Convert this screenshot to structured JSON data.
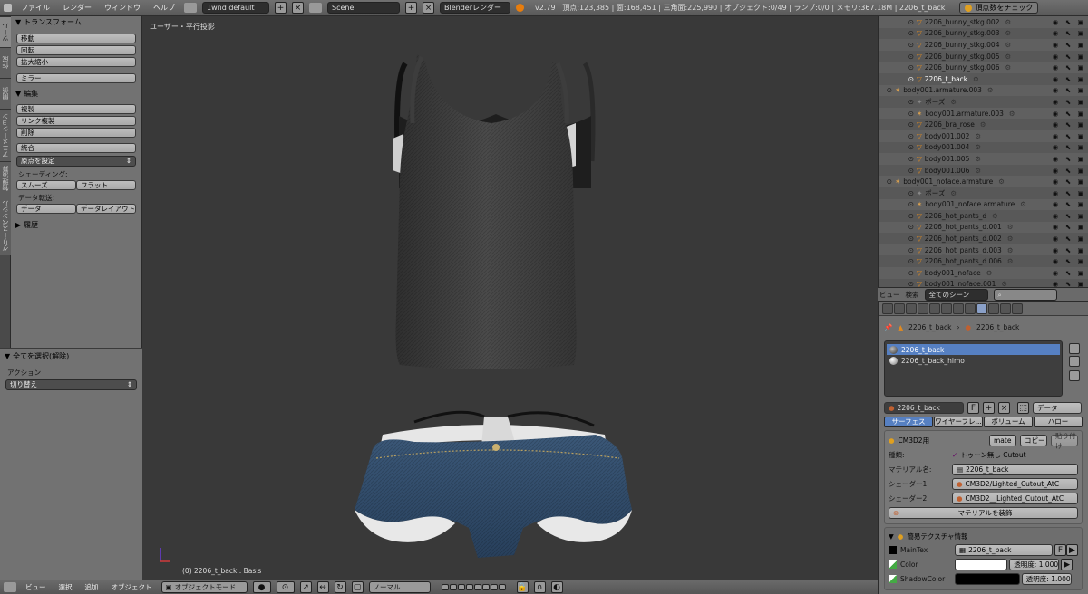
{
  "topbar": {
    "menus": [
      "ファイル",
      "レンダー",
      "ウィンドウ",
      "ヘルプ"
    ],
    "layout": "1wnd default",
    "scene": "Scene",
    "engine": "Blenderレンダー",
    "stats": "v2.79 | 頂点:123,385 | 面:168,451 | 三角面:225,990 | オブジェクト:0/49 | ランプ:0/0 | メモリ:367.18M | 2206_t_back",
    "check_button": "頂点数をチェック"
  },
  "vtabs": [
    "ツール",
    "作成",
    "関係",
    "アニメーション",
    "物理演算",
    "グリースペンシル"
  ],
  "tools": {
    "transform_header": "トランスフォーム",
    "transform_buttons": [
      "移動",
      "回転",
      "拡大縮小"
    ],
    "mirror": "ミラー",
    "edit_header": "編集",
    "edit_buttons": [
      "複製",
      "リンク複製",
      "削除"
    ],
    "join": "統合",
    "origin": "原点を設定",
    "shading_label": "シェーディング:",
    "smooth": "スムーズ",
    "flat": "フラット",
    "data_transfer_label": "データ転送:",
    "data": "データ",
    "data_layout": "データレイアウト",
    "history": "履歴"
  },
  "operator": {
    "header": "全てを選択(解除)",
    "action_label": "アクション",
    "action_value": "切り替え"
  },
  "viewport": {
    "label": "ユーザー・平行投影",
    "status": "(0) 2206_t_back : Basis"
  },
  "bottombar": {
    "menus": [
      "ビュー",
      "選択",
      "追加",
      "オブジェクト"
    ],
    "mode": "オブジェクトモード",
    "pivot": "ノーマル"
  },
  "outliner": {
    "rows": [
      {
        "name": "2206_bunny_stkg.002",
        "indent": 3,
        "icon": "mesh"
      },
      {
        "name": "2206_bunny_stkg.003",
        "indent": 3,
        "icon": "mesh"
      },
      {
        "name": "2206_bunny_stkg.004",
        "indent": 3,
        "icon": "mesh"
      },
      {
        "name": "2206_bunny_stkg.005",
        "indent": 3,
        "icon": "mesh"
      },
      {
        "name": "2206_bunny_stkg.006",
        "indent": 3,
        "icon": "mesh"
      },
      {
        "name": "2206_t_back",
        "indent": 3,
        "icon": "mesh",
        "selected": true
      },
      {
        "name": "body001.armature.003",
        "indent": 1,
        "icon": "armature"
      },
      {
        "name": "ポーズ",
        "indent": 3,
        "icon": "pose"
      },
      {
        "name": "body001.armature.003",
        "indent": 3,
        "icon": "armature"
      },
      {
        "name": "2206_bra_rose",
        "indent": 3,
        "icon": "mesh"
      },
      {
        "name": "body001.002",
        "indent": 3,
        "icon": "mesh"
      },
      {
        "name": "body001.004",
        "indent": 3,
        "icon": "mesh"
      },
      {
        "name": "body001.005",
        "indent": 3,
        "icon": "mesh"
      },
      {
        "name": "body001.006",
        "indent": 3,
        "icon": "mesh"
      },
      {
        "name": "body001_noface.armature",
        "indent": 1,
        "icon": "armature"
      },
      {
        "name": "ポーズ",
        "indent": 3,
        "icon": "pose"
      },
      {
        "name": "body001_noface.armature",
        "indent": 3,
        "icon": "armature"
      },
      {
        "name": "2206_hot_pants_d",
        "indent": 3,
        "icon": "mesh"
      },
      {
        "name": "2206_hot_pants_d.001",
        "indent": 3,
        "icon": "mesh"
      },
      {
        "name": "2206_hot_pants_d.002",
        "indent": 3,
        "icon": "mesh"
      },
      {
        "name": "2206_hot_pants_d.003",
        "indent": 3,
        "icon": "mesh"
      },
      {
        "name": "2206_hot_pants_d.006",
        "indent": 3,
        "icon": "mesh"
      },
      {
        "name": "body001_noface",
        "indent": 3,
        "icon": "mesh"
      },
      {
        "name": "body001_noface.001",
        "indent": 3,
        "icon": "mesh"
      }
    ],
    "header": {
      "view": "ビュー",
      "search": "検索",
      "filter": "全てのシーン"
    }
  },
  "properties": {
    "breadcrumb_object": "2206_t_back",
    "breadcrumb_material": "2206_t_back",
    "slots": [
      "2206_t_back",
      "2206_t_back_himo"
    ],
    "material_name": "2206_t_back",
    "fake_user": "F",
    "link": "データ",
    "tabs": [
      "サーフェス",
      "ワイヤーフレ...",
      "ボリューム",
      "ハロー"
    ],
    "cm3d2": {
      "header": "CM3D2用",
      "mate_button": "mate",
      "copy_button": "コピー",
      "paste_button": "貼り付け",
      "type_label": "種類:",
      "type_value": "トゥーン無し Cutout",
      "matname_label": "マテリアル名:",
      "matname_value": "2206_t_back",
      "shader1_label": "シェーダー1:",
      "shader1_value": "CM3D2/Lighted_Cutout_AtC",
      "shader2_label": "シェーダー2:",
      "shader2_value": "CM3D2__Lighted_Cutout_AtC",
      "decorate_button": "マテリアルを装飾"
    },
    "texture": {
      "header": "簡易テクスチャ情報",
      "maintex_label": "MainTex",
      "maintex_value": "2206_t_back",
      "color_label": "Color",
      "color_alpha": "透明度: 1.000",
      "shadow_label": "ShadowColor",
      "shadow_alpha": "透明度: 1.000"
    }
  }
}
